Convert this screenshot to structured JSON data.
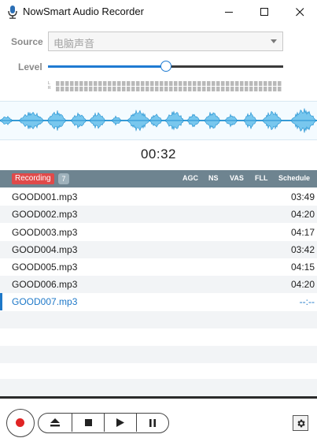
{
  "window": {
    "title": "NowSmart Audio Recorder",
    "icon": "microphone-icon",
    "controls": [
      "minimize-icon",
      "maximize-icon",
      "close-icon"
    ]
  },
  "source": {
    "label": "Source",
    "value": "电脑声音"
  },
  "level": {
    "label": "Level",
    "value_fraction": 0.5,
    "meter_labels": [
      "L",
      "R"
    ]
  },
  "timer": "00:32",
  "list_header": {
    "status_badge": "Recording",
    "count": "7",
    "columns": [
      "AGC",
      "NS",
      "VAS",
      "FLL",
      "Schedule"
    ]
  },
  "files": [
    {
      "name": "GOOD001.mp3",
      "duration": "03:49"
    },
    {
      "name": "GOOD002.mp3",
      "duration": "04:20"
    },
    {
      "name": "GOOD003.mp3",
      "duration": "04:17"
    },
    {
      "name": "GOOD004.mp3",
      "duration": "03:42"
    },
    {
      "name": "GOOD005.mp3",
      "duration": "04:15"
    },
    {
      "name": "GOOD006.mp3",
      "duration": "04:20"
    },
    {
      "name": "GOOD007.mp3",
      "duration": "--:--"
    }
  ],
  "controls": {
    "record": "record-icon",
    "eject": "eject-icon",
    "stop": "stop-icon",
    "play": "play-icon",
    "pause": "pause-icon",
    "settings": "gear-icon"
  },
  "colors": {
    "accent": "#1e78c8",
    "record": "#e02424",
    "header": "#6e8490",
    "badge": "#e04a4a",
    "waveform": "#4fb6e8"
  }
}
